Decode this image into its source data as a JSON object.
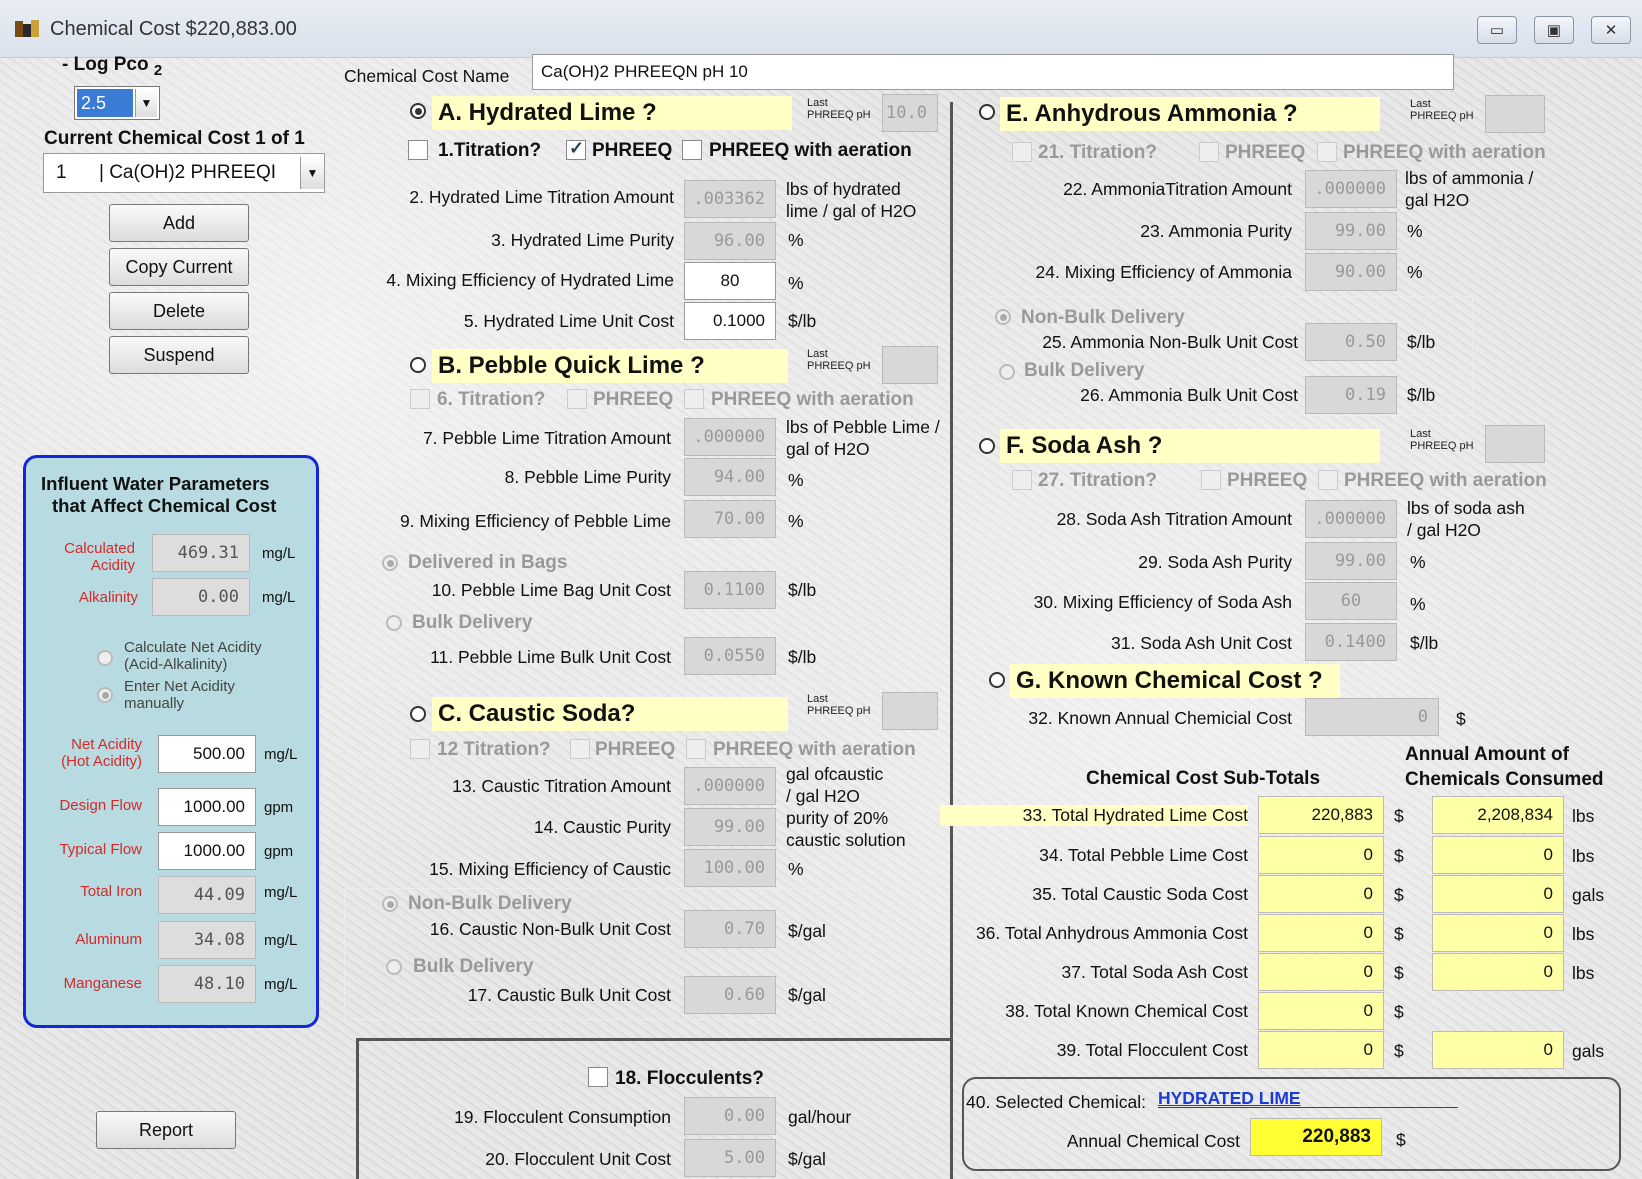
{
  "window": {
    "title": "Chemical Cost $220,883.00",
    "min_icon": "minimize-icon",
    "max_icon": "maximize-icon",
    "close_icon": "close-icon"
  },
  "left": {
    "log_pco_label": "- Log Pco",
    "log_pco_sub": "2",
    "log_pco_value": "2.5",
    "current_label": "Current Chemical Cost  1 of  1",
    "current_value_num": "1",
    "current_value_name": "| Ca(OH)2 PHREEQI",
    "buttons": {
      "add": "Add",
      "copy": "Copy Current",
      "delete": "Delete",
      "suspend": "Suspend",
      "report": "Report"
    },
    "influent": {
      "title1": "Influent Water Parameters",
      "title2": "that Affect Chemical Cost",
      "calc_acidity_1": "Calculated",
      "calc_acidity_2": "Acidity",
      "calc_acidity_val": "469.31",
      "calc_acidity_unit": "mg/L",
      "alkalinity": "Alkalinity",
      "alkalinity_val": "0.00",
      "alkalinity_unit": "mg/L",
      "opt_calc_1": "Calculate Net Acidity",
      "opt_calc_2": "(Acid-Alkalinity)",
      "opt_enter_1": "Enter Net Acidity",
      "opt_enter_2": "manually",
      "net_acidity_1": "Net Acidity",
      "net_acidity_2": "(Hot Acidity)",
      "net_acidity_val": "500.00",
      "net_acidity_unit": "mg/L",
      "design_flow": "Design Flow",
      "design_flow_val": "1000.00",
      "design_flow_unit": "gpm",
      "typical_flow": "Typical Flow",
      "typical_flow_val": "1000.00",
      "typical_flow_unit": "gpm",
      "total_iron": "Total Iron",
      "total_iron_val": "44.09",
      "total_iron_unit": "mg/L",
      "aluminum": "Aluminum",
      "aluminum_val": "34.08",
      "aluminum_unit": "mg/L",
      "manganese": "Manganese",
      "manganese_val": "48.10",
      "manganese_unit": "mg/L"
    }
  },
  "name": {
    "label": "Chemical Cost  Name",
    "value": "Ca(OH)2 PHREEQN pH 10"
  },
  "last_ph_1": "Last",
  "last_ph_2": "PHREEQ pH",
  "A": {
    "header": "A. Hydrated Lime ?",
    "last_ph": "10.0",
    "titration": "1.Titration?",
    "phreeq": "PHREEQ",
    "aeration": "PHREEQ with aeration",
    "f2": "2. Hydrated Lime Titration Amount",
    "f2v": ".003362",
    "f2u1": "lbs of hydrated",
    "f2u2": "lime / gal of H2O",
    "f3": "3. Hydrated Lime Purity",
    "f3v": "96.00",
    "f3u": "%",
    "f4": "4. Mixing Efficiency of Hydrated Lime",
    "f4v": "80",
    "f4u": "%",
    "f5": "5. Hydrated Lime Unit Cost",
    "f5v": "0.1000",
    "f5u": "$/lb"
  },
  "B": {
    "header": "B. Pebble Quick Lime ?",
    "titration": "6. Titration?",
    "phreeq": "PHREEQ",
    "aeration": "PHREEQ with aeration",
    "f7": "7. Pebble Lime Titration Amount",
    "f7v": ".000000",
    "f7u1": "lbs of Pebble Lime /",
    "f7u2": "gal of H2O",
    "f8": "8. Pebble Lime Purity",
    "f8v": "94.00",
    "f8u": "%",
    "f9": "9. Mixing Efficiency of Pebble Lime",
    "f9v": "70.00",
    "f9u": "%",
    "bags": "Delivered in Bags",
    "f10": "10. Pebble Lime Bag Unit Cost",
    "f10v": "0.1100",
    "f10u": "$/lb",
    "bulk": "Bulk Delivery",
    "f11": "11. Pebble Lime Bulk Unit Cost",
    "f11v": "0.0550",
    "f11u": "$/lb"
  },
  "C": {
    "header": "C. Caustic Soda?",
    "titration": "12 Titration?",
    "phreeq": "PHREEQ",
    "aeration": "PHREEQ with aeration",
    "f13": "13. Caustic Titration Amount",
    "f13v": ".000000",
    "f13u1": "gal ofcaustic",
    "f13u2": "/ gal H2O",
    "f14": "14. Caustic Purity",
    "f14v": "99.00",
    "f14u1": "purity of 20%",
    "f14u2": "caustic solution",
    "f15": "15. Mixing Efficiency of Caustic",
    "f15v": "100.00",
    "f15u": "%",
    "nonbulk": "Non-Bulk Delivery",
    "f16": "16. Caustic Non-Bulk Unit Cost",
    "f16v": "0.70",
    "f16u": "$/gal",
    "bulk": "Bulk Delivery",
    "f17": "17. Caustic Bulk Unit Cost",
    "f17v": "0.60",
    "f17u": "$/gal"
  },
  "floc": {
    "header": "18. Flocculents?",
    "f19": "19. Flocculent Consumption",
    "f19v": "0.00",
    "f19u": "gal/hour",
    "f20": "20. Flocculent Unit Cost",
    "f20v": "5.00",
    "f20u": "$/gal"
  },
  "E": {
    "header": "E. Anhydrous Ammonia ?",
    "titration": "21. Titration?",
    "phreeq": "PHREEQ",
    "aeration": "PHREEQ with aeration",
    "f22": "22. AmmoniaTitration Amount",
    "f22v": ".000000",
    "f22u1": "lbs of ammonia /",
    "f22u2": "gal H2O",
    "f23": "23. Ammonia Purity",
    "f23v": "99.00",
    "f23u": "%",
    "f24": "24. Mixing Efficiency of Ammonia",
    "f24v": "90.00",
    "f24u": "%",
    "nonbulk": "Non-Bulk Delivery",
    "f25": "25. Ammonia Non-Bulk Unit Cost",
    "f25v": "0.50",
    "f25u": "$/lb",
    "bulk": "Bulk Delivery",
    "f26": "26. Ammonia Bulk Unit Cost",
    "f26v": "0.19",
    "f26u": "$/lb"
  },
  "F": {
    "header": "F. Soda Ash ?",
    "titration": "27. Titration?",
    "phreeq": "PHREEQ",
    "aeration": "PHREEQ with aeration",
    "f28": "28. Soda Ash Titration Amount",
    "f28v": ".000000",
    "f28u1": "lbs of soda ash",
    "f28u2": "/ gal H2O",
    "f29": "29. Soda Ash Purity",
    "f29v": "99.00",
    "f29u": "%",
    "f30": "30. Mixing Efficiency of Soda Ash",
    "f30v": "60",
    "f30u": "%",
    "f31": "31. Soda Ash Unit Cost",
    "f31v": "0.1400",
    "f31u": "$/lb"
  },
  "G": {
    "header": "G. Known Chemical Cost ?",
    "f32": "32. Known Annual Chemicial Cost",
    "f32v": "0",
    "f32u": "$"
  },
  "totals": {
    "sub_header": "Chemical Cost Sub-Totals",
    "annual_header1": "Annual Amount of",
    "annual_header2": "Chemicals Consumed",
    "rows": [
      {
        "label": "33. Total Hydrated Lime Cost",
        "cost": "220,883",
        "cu": "$",
        "amt": "2,208,834",
        "au": "lbs"
      },
      {
        "label": "34. Total Pebble Lime Cost",
        "cost": "0",
        "cu": "$",
        "amt": "0",
        "au": "lbs"
      },
      {
        "label": "35. Total Caustic Soda Cost",
        "cost": "0",
        "cu": "$",
        "amt": "0",
        "au": "gals"
      },
      {
        "label": "36. Total Anhydrous Ammonia Cost",
        "cost": "0",
        "cu": "$",
        "amt": "0",
        "au": "lbs"
      },
      {
        "label": "37. Total Soda Ash Cost",
        "cost": "0",
        "cu": "$",
        "amt": "0",
        "au": "lbs"
      },
      {
        "label": "38. Total Known Chemical Cost",
        "cost": "0",
        "cu": "$",
        "amt": "",
        "au": ""
      },
      {
        "label": "39. Total Flocculent Cost",
        "cost": "0",
        "cu": "$",
        "amt": "0",
        "au": "gals"
      }
    ],
    "selected_label": "40. Selected Chemical:",
    "selected_value": "HYDRATED LIME",
    "annual_label": "Annual Chemical Cost",
    "annual_value": "220,883",
    "annual_unit": "$"
  }
}
